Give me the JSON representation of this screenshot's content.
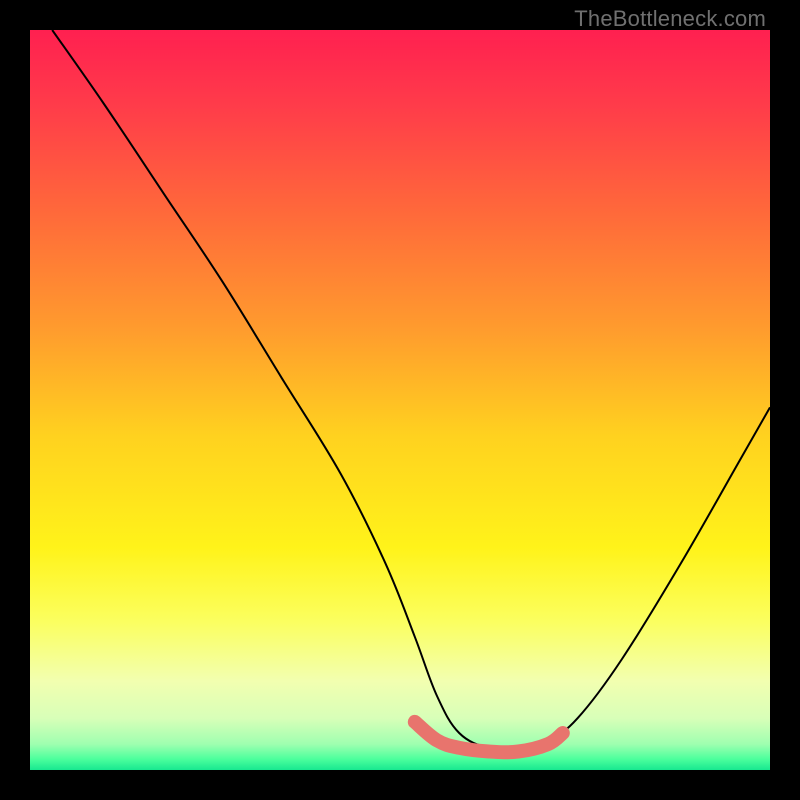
{
  "watermark": "TheBottleneck.com",
  "gradient_stops": [
    {
      "offset": 0.0,
      "color": "#ff2050"
    },
    {
      "offset": 0.1,
      "color": "#ff3b4a"
    },
    {
      "offset": 0.25,
      "color": "#ff6a3a"
    },
    {
      "offset": 0.4,
      "color": "#ff9a2e"
    },
    {
      "offset": 0.55,
      "color": "#ffd21f"
    },
    {
      "offset": 0.7,
      "color": "#fff31a"
    },
    {
      "offset": 0.8,
      "color": "#fbff60"
    },
    {
      "offset": 0.88,
      "color": "#f2ffb0"
    },
    {
      "offset": 0.93,
      "color": "#d8ffb8"
    },
    {
      "offset": 0.965,
      "color": "#9fffb0"
    },
    {
      "offset": 0.985,
      "color": "#4dff9d"
    },
    {
      "offset": 1.0,
      "color": "#18e890"
    }
  ],
  "chart_data": {
    "type": "line",
    "title": "",
    "xlabel": "",
    "ylabel": "",
    "xlim": [
      0,
      100
    ],
    "ylim": [
      0,
      100
    ],
    "series": [
      {
        "name": "bottleneck-curve",
        "color": "#000000",
        "stroke_width": 2,
        "x": [
          3,
          10,
          18,
          26,
          34,
          42,
          48,
          52,
          55,
          58,
          62,
          66,
          70,
          74,
          80,
          88,
          96,
          100
        ],
        "y": [
          100,
          90,
          78,
          66,
          53,
          40,
          28,
          18,
          10,
          5,
          3,
          3,
          4,
          7,
          15,
          28,
          42,
          49
        ]
      },
      {
        "name": "highlight-band",
        "color": "#e8746d",
        "stroke_width": 14,
        "linecap": "round",
        "x": [
          52,
          55,
          58,
          62,
          66,
          70,
          72
        ],
        "y": [
          6.5,
          4,
          3,
          2.5,
          2.5,
          3.5,
          5
        ]
      }
    ],
    "annotations": []
  }
}
